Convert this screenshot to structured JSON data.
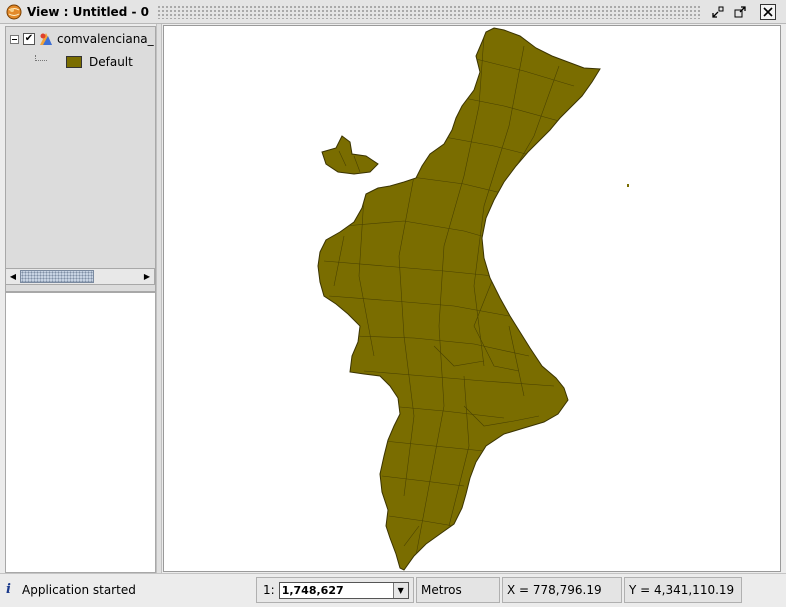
{
  "window": {
    "title": "View : Untitled - 0",
    "buttons": [
      "minimize-icon",
      "maximize-icon",
      "close-icon"
    ]
  },
  "toc": {
    "layers": [
      {
        "name": "comvalenciana_",
        "visible": true,
        "expanded": true,
        "legend": [
          {
            "label": "Default",
            "color": "#7a6d00"
          }
        ]
      }
    ]
  },
  "map": {
    "background": "#ffffff",
    "fill_color": "#7a6d00",
    "stroke_color": "#3a3300"
  },
  "status": {
    "message": "Application started",
    "scale_prefix": "1:",
    "scale_value": "1,748,627",
    "units": "Metros",
    "x_readout": "X = 778,796.19",
    "y_readout": "Y = 4,341,110.19"
  }
}
